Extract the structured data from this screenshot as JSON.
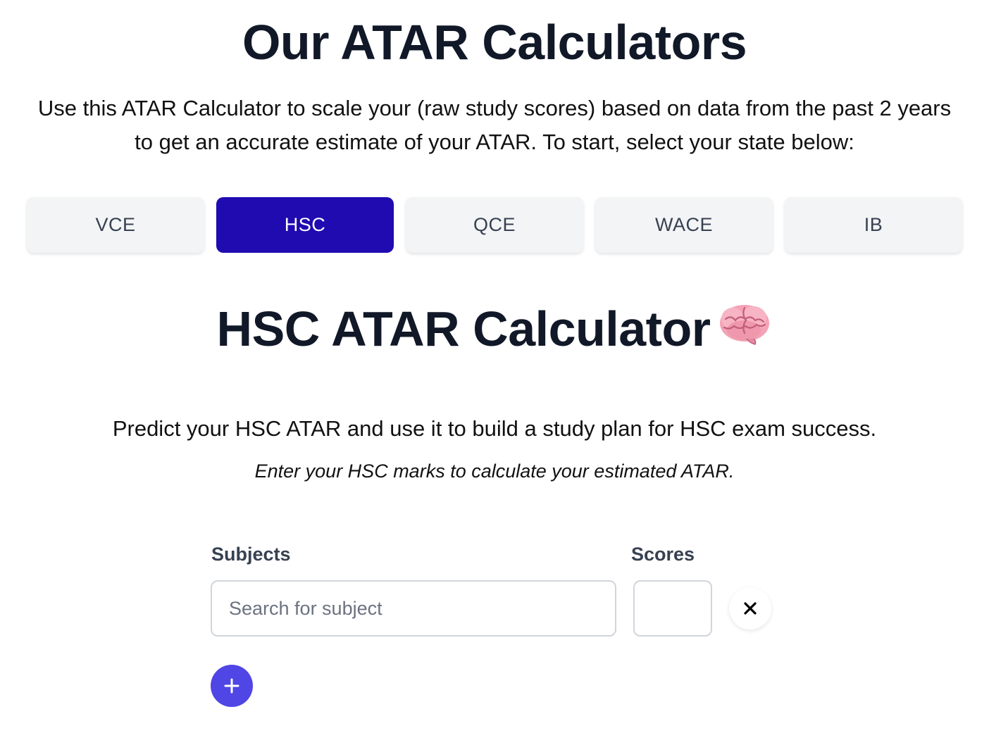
{
  "header": {
    "title": "Our ATAR Calculators",
    "intro": "Use this ATAR Calculator to scale your (raw study scores) based on data from the past 2 years to get an accurate estimate of your ATAR. To start, select your state below:"
  },
  "tabs": [
    {
      "label": "VCE",
      "active": false
    },
    {
      "label": "HSC",
      "active": true
    },
    {
      "label": "QCE",
      "active": false
    },
    {
      "label": "WACE",
      "active": false
    },
    {
      "label": "IB",
      "active": false
    }
  ],
  "calculator": {
    "title": "HSC ATAR Calculator",
    "title_icon": "brain-icon",
    "description": "Predict your HSC ATAR and use it to build a study plan for HSC exam success.",
    "instruction": "Enter your HSC marks to calculate your estimated ATAR.",
    "subjects_label": "Subjects",
    "scores_label": "Scores",
    "subject_placeholder": "Search for subject",
    "subject_value": "",
    "score_value": "",
    "remove_icon": "close-icon",
    "add_icon": "plus-icon"
  },
  "colors": {
    "active_tab": "#1f0bb0",
    "tab_bg": "#f3f4f6",
    "add_button": "#4f46e5",
    "heading": "#111827"
  }
}
